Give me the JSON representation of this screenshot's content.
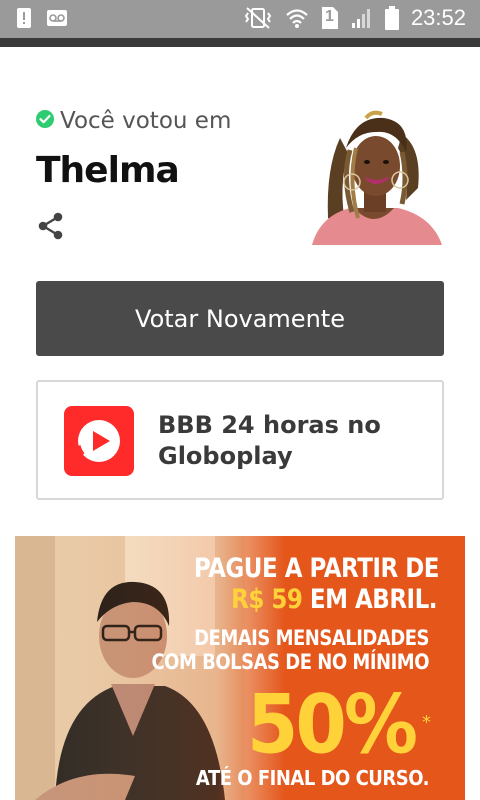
{
  "status_bar": {
    "time": "23:52",
    "sim_number": "1",
    "icons": [
      "alert-icon",
      "voicemail-icon",
      "vibrate-icon",
      "wifi-icon",
      "sim-icon",
      "signal-icon",
      "battery-icon"
    ]
  },
  "result": {
    "voted_label": "Você votou em",
    "candidate_name": "Thelma",
    "check_color": "#2ecc71"
  },
  "actions": {
    "vote_again_label": "Votar Novamente"
  },
  "globoplay": {
    "title": "BBB 24 horas no Globoplay",
    "brand_color": "#ff2a2a"
  },
  "ad": {
    "line1": "PAGUE A PARTIR DE",
    "price": "R$ 59",
    "price_suffix": " EM ABRIL.",
    "line3": "DEMAIS MENSALIDADES",
    "line4": "COM BOLSAS DE NO MÍNIMO",
    "discount": "50%",
    "asterisk": "*",
    "line5": "ATÉ O FINAL DO CURSO.",
    "bg_color": "#e5561b",
    "highlight_color": "#ffd23a"
  }
}
